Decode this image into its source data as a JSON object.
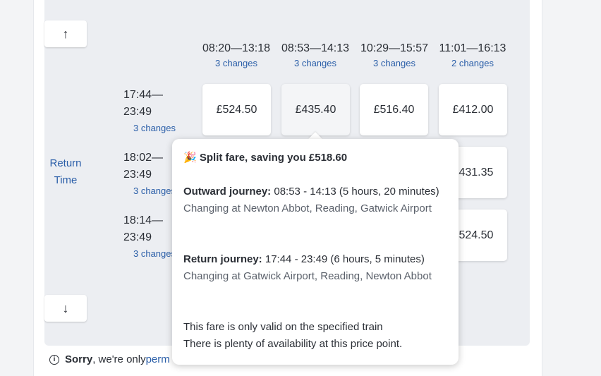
{
  "nav": {
    "up_arrow": "↑",
    "down_arrow": "↓"
  },
  "axis": {
    "return_time": "Return Time"
  },
  "outward_columns": [
    {
      "time": "08:20—13:18",
      "changes": "3 changes"
    },
    {
      "time": "08:53—14:13",
      "changes": "3 changes"
    },
    {
      "time": "10:29—15:57",
      "changes": "3 changes"
    },
    {
      "time": "11:01—16:13",
      "changes": "2 changes"
    }
  ],
  "return_rows": [
    {
      "time": "17:44—23:49",
      "changes": "3 changes",
      "prices": [
        "£524.50",
        "£435.40",
        "£516.40",
        "£412.00"
      ]
    },
    {
      "time": "18:02—23:49",
      "changes": "3 changes",
      "prices": [
        "",
        "",
        "",
        "£431.35"
      ]
    },
    {
      "time": "18:14—23:49",
      "changes": "3 changes",
      "prices": [
        "",
        "",
        "",
        "£524.50"
      ]
    }
  ],
  "tooltip": {
    "title": "Split fare, saving you £518.60",
    "outward_label": "Outward journey:",
    "outward_detail": "08:53 - 14:13 (5 hours, 20 minutes)",
    "outward_changing": "Changing at Newton Abbot, Reading, Gatwick Airport",
    "return_label": "Return journey:",
    "return_detail": "17:44 - 23:49 (6 hours, 5 minutes)",
    "return_changing": "Changing at Gatwick Airport, Reading, Newton Abbot",
    "validity": "This fare is only valid on the specified train",
    "availability": "There is plenty of availability at this price point."
  },
  "notice": {
    "strong": "Sorry",
    "text": ", we're only ",
    "link": "perm"
  },
  "colors": {
    "accent_link": "#2a5ea8",
    "panel": "#eceef2",
    "card": "#ffffff",
    "selected_green": "#e6f4e6"
  },
  "icons": {
    "notice": "info-icon",
    "tooltip_title": "party-popper-icon"
  }
}
